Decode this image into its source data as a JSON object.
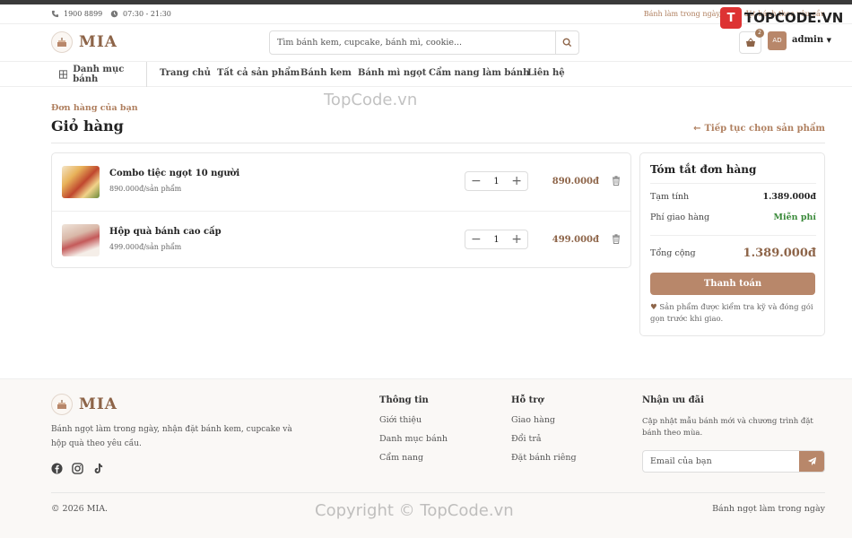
{
  "topbar": {
    "phone": "1900 8899",
    "hours": "07:30 - 21:30",
    "promo": "Bánh làm trong ngày, nhận đặt bánh theo yêu cầu"
  },
  "brand": {
    "name": "MIA",
    "watermark_logo": "TOPCODE.VN"
  },
  "header": {
    "search_placeholder": "Tìm bánh kem, cupcake, bánh mì, cookie...",
    "cart_count": "2",
    "avatar_initials": "AD",
    "user_name": "admin"
  },
  "nav": {
    "category_button": "Danh mục bánh",
    "items": [
      "Trang chủ",
      "Tất cả sản phẩm",
      "Bánh kem",
      "Bánh mì ngọt",
      "Cẩm nang làm bánh",
      "Liên hệ"
    ]
  },
  "page": {
    "breadcrumb": "Đơn hàng của bạn",
    "title": "Giỏ hàng",
    "continue_link": "Tiếp tục chọn sản phẩm"
  },
  "cart": {
    "items": [
      {
        "name": "Combo tiệc ngọt 10 người",
        "unit_price": "890.000đ/sản phẩm",
        "quantity": "1",
        "total": "890.000đ"
      },
      {
        "name": "Hộp quà bánh cao cấp",
        "unit_price": "499.000đ/sản phẩm",
        "quantity": "1",
        "total": "499.000đ"
      }
    ]
  },
  "summary": {
    "title": "Tóm tắt đơn hàng",
    "subtotal_label": "Tạm tính",
    "subtotal_value": "1.389.000đ",
    "shipping_label": "Phí giao hàng",
    "shipping_value": "Miễn phí",
    "total_label": "Tổng cộng",
    "total_value": "1.389.000đ",
    "checkout_button": "Thanh toán",
    "note": "Sản phẩm được kiểm tra kỹ và đóng gói gọn trước khi giao."
  },
  "footer": {
    "description": "Bánh ngọt làm trong ngày, nhận đặt bánh kem, cupcake và hộp quà theo yêu cầu.",
    "col_info": {
      "title": "Thông tin",
      "links": [
        "Giới thiệu",
        "Danh mục bánh",
        "Cẩm nang"
      ]
    },
    "col_support": {
      "title": "Hỗ trợ",
      "links": [
        "Giao hàng",
        "Đổi trả",
        "Đặt bánh riêng"
      ]
    },
    "newsletter": {
      "title": "Nhận ưu đãi",
      "text": "Cập nhật mẫu bánh mới và chương trình đặt bánh theo mùa.",
      "placeholder": "Email của bạn"
    },
    "copyright": "© 2026 MIA.",
    "tagline": "Bánh ngọt làm trong ngày"
  },
  "watermarks": {
    "center": "TopCode.vn",
    "bottom": "Copyright © TopCode.vn"
  },
  "colors": {
    "accent": "#b8876a",
    "accent_dark": "#8d6448",
    "success": "#3a8a3a"
  }
}
